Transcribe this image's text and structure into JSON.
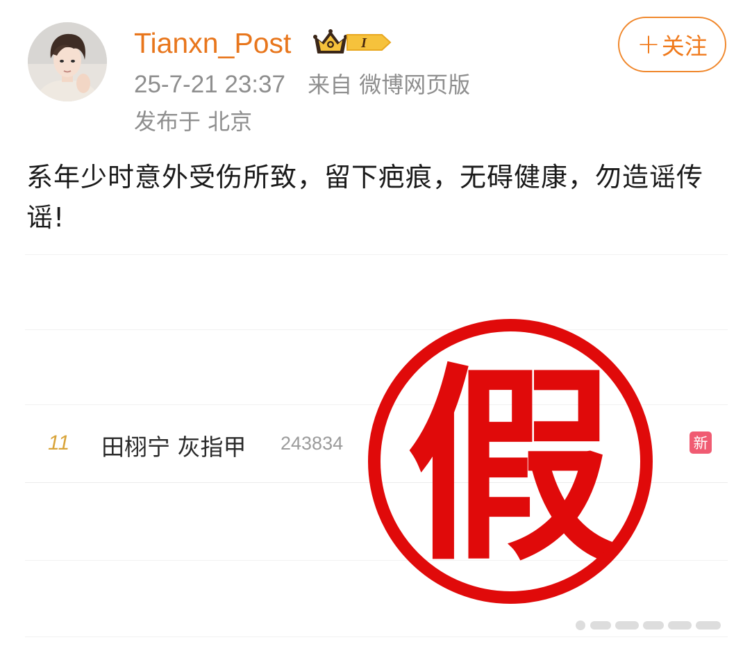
{
  "post": {
    "username": "Tianxn_Post",
    "vip_level": "I",
    "follow_label": "关注",
    "timestamp": "25-7-21 23:37",
    "source": "来自 微博网页版",
    "location": "发布于 北京",
    "text": "系年少时意外受伤所致，留下疤痕，无碍健康，勿造谣传谣!"
  },
  "image": {
    "hot_search": {
      "rank": "11",
      "title": "田栩宁 灰指甲",
      "count": "243834",
      "badge": "新"
    },
    "stamp_text": "假"
  },
  "colors": {
    "username": "#e8761c",
    "follow": "#f07a1c",
    "meta": "#8e8e8e",
    "stamp": "#e00a0a",
    "new_badge": "#f05b72",
    "rank": "#d9a43a"
  },
  "icons": [
    "user-avatar",
    "crown-icon",
    "vip-badge-icon",
    "plus-icon",
    "fake-stamp",
    "hot-new-badge"
  ]
}
